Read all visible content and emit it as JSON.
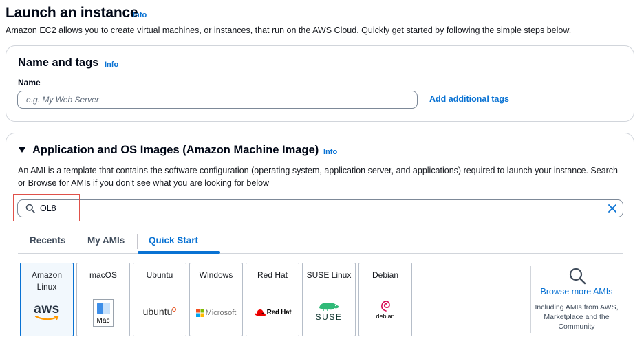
{
  "page": {
    "title": "Launch an instance",
    "info": "Info",
    "description": "Amazon EC2 allows you to create virtual machines, or instances, that run on the AWS Cloud. Quickly get started by following the simple steps below."
  },
  "name_tags": {
    "heading": "Name and tags",
    "info": "Info",
    "name_label": "Name",
    "name_placeholder": "e.g. My Web Server",
    "name_value": "",
    "add_tags_label": "Add additional tags"
  },
  "ami": {
    "heading": "Application and OS Images (Amazon Machine Image)",
    "info": "Info",
    "description": "An AMI is a template that contains the software configuration (operating system, application server, and applications) required to launch your instance. Search or Browse for AMIs if you don't see what you are looking for below",
    "search_value": "OL8",
    "tabs": [
      {
        "label": "Recents"
      },
      {
        "label": "My AMIs"
      },
      {
        "label": "Quick Start",
        "active": true
      }
    ],
    "tiles": [
      {
        "name": "Amazon\nLinux",
        "logo_text": "aws",
        "selected": true
      },
      {
        "name": "macOS",
        "logo_text": "Mac"
      },
      {
        "name": "Ubuntu",
        "logo_text": "ubuntu"
      },
      {
        "name": "Windows",
        "logo_text": "Microsoft"
      },
      {
        "name": "Red Hat",
        "logo_text": "Red Hat"
      },
      {
        "name": "SUSE Linux",
        "logo_text": "SUSE"
      },
      {
        "name": "Debian",
        "logo_text": "debian"
      }
    ],
    "browse_label": "Browse more AMIs",
    "browse_description": "Including AMIs from AWS, Marketplace and the Community"
  },
  "colors": {
    "link": "#0972d3",
    "highlight": "#e0514a",
    "selected_tile_bg": "#f2f8fd"
  }
}
